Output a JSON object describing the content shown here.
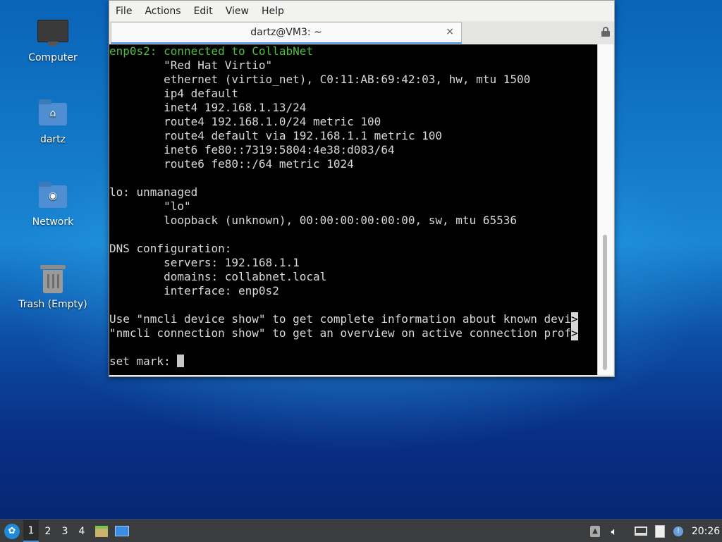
{
  "desktop": {
    "icons": [
      {
        "label": "Computer"
      },
      {
        "label": "dartz"
      },
      {
        "label": "Network"
      },
      {
        "label": "Trash (Empty)"
      }
    ]
  },
  "window": {
    "menu": [
      "File",
      "Actions",
      "Edit",
      "View",
      "Help"
    ],
    "tab_title": "dartz@VM3: ~",
    "close_glyph": "×"
  },
  "terminal": {
    "lines": [
      "enp0s2: connected to CollabNet",
      "        \"Red Hat Virtio\"",
      "        ethernet (virtio_net), C0:11:AB:69:42:03, hw, mtu 1500",
      "        ip4 default",
      "        inet4 192.168.1.13/24",
      "        route4 192.168.1.0/24 metric 100",
      "        route4 default via 192.168.1.1 metric 100",
      "        inet6 fe80::7319:5804:4e38:d083/64",
      "        route6 fe80::/64 metric 1024",
      "",
      "lo: unmanaged",
      "        \"lo\"",
      "        loopback (unknown), 00:00:00:00:00:00, sw, mtu 65536",
      "",
      "DNS configuration:",
      "        servers: 192.168.1.1",
      "        domains: collabnet.local",
      "        interface: enp0s2",
      "",
      "Use \"nmcli device show\" to get complete information about known devi",
      "\"nmcli connection show\" to get an overview on active connection prof",
      "",
      "set mark: "
    ],
    "truncation_marker": ">"
  },
  "taskbar": {
    "workspaces": [
      "1",
      "2",
      "3",
      "4"
    ],
    "clock": "20:26"
  }
}
